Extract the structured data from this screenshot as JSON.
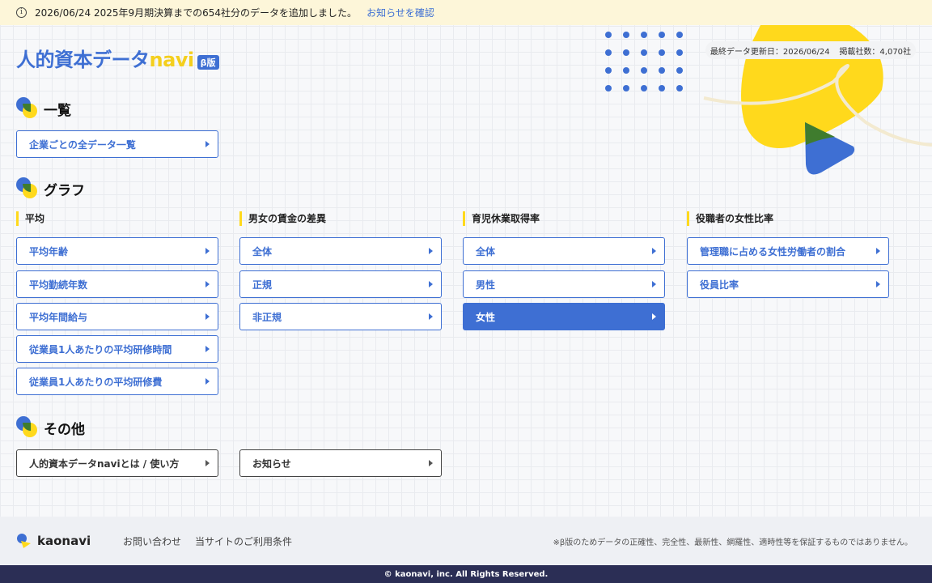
{
  "notice": {
    "text": "2026/06/24 2025年9月期決算までの654社分のデータを追加しました。",
    "link": "お知らせを確認"
  },
  "logo": {
    "text_main": "人的資本データ",
    "text_navi": "navi",
    "beta": "β版"
  },
  "meta": {
    "updated": "最終データ更新日：2026/06/24",
    "count": "掲載社数：4,070社"
  },
  "sections": {
    "list": {
      "title": "一覧",
      "button": "企業ごとの全データ一覧"
    },
    "graph": {
      "title": "グラフ",
      "columns": [
        {
          "heading": "平均",
          "items": [
            "平均年齢",
            "平均勤続年数",
            "平均年間給与",
            "従業員1人あたりの平均研修時間",
            "従業員1人あたりの平均研修費"
          ]
        },
        {
          "heading": "男女の賃金の差異",
          "items": [
            "全体",
            "正規",
            "非正規"
          ]
        },
        {
          "heading": "育児休業取得率",
          "items": [
            "全体",
            "男性",
            "女性"
          ],
          "active_index": 2
        },
        {
          "heading": "役職者の女性比率",
          "items": [
            "管理職に占める女性労働者の割合",
            "役員比率"
          ]
        }
      ]
    },
    "other": {
      "title": "その他",
      "items": [
        "人的資本データnaviとは / 使い方",
        "お知らせ"
      ]
    }
  },
  "footer": {
    "brand": "kaonavi",
    "links": [
      "お問い合わせ",
      "当サイトのご利用条件"
    ],
    "disclaimer": "※β版のためデータの正確性、完全性、最新性、網羅性、適時性等を保証するものではありません。",
    "copyright": "© kaonavi, inc. All Rights Reserved."
  },
  "colors": {
    "accent": "#3e6fd3",
    "yellow": "#ffd91c",
    "navy": "#2b2e55"
  }
}
